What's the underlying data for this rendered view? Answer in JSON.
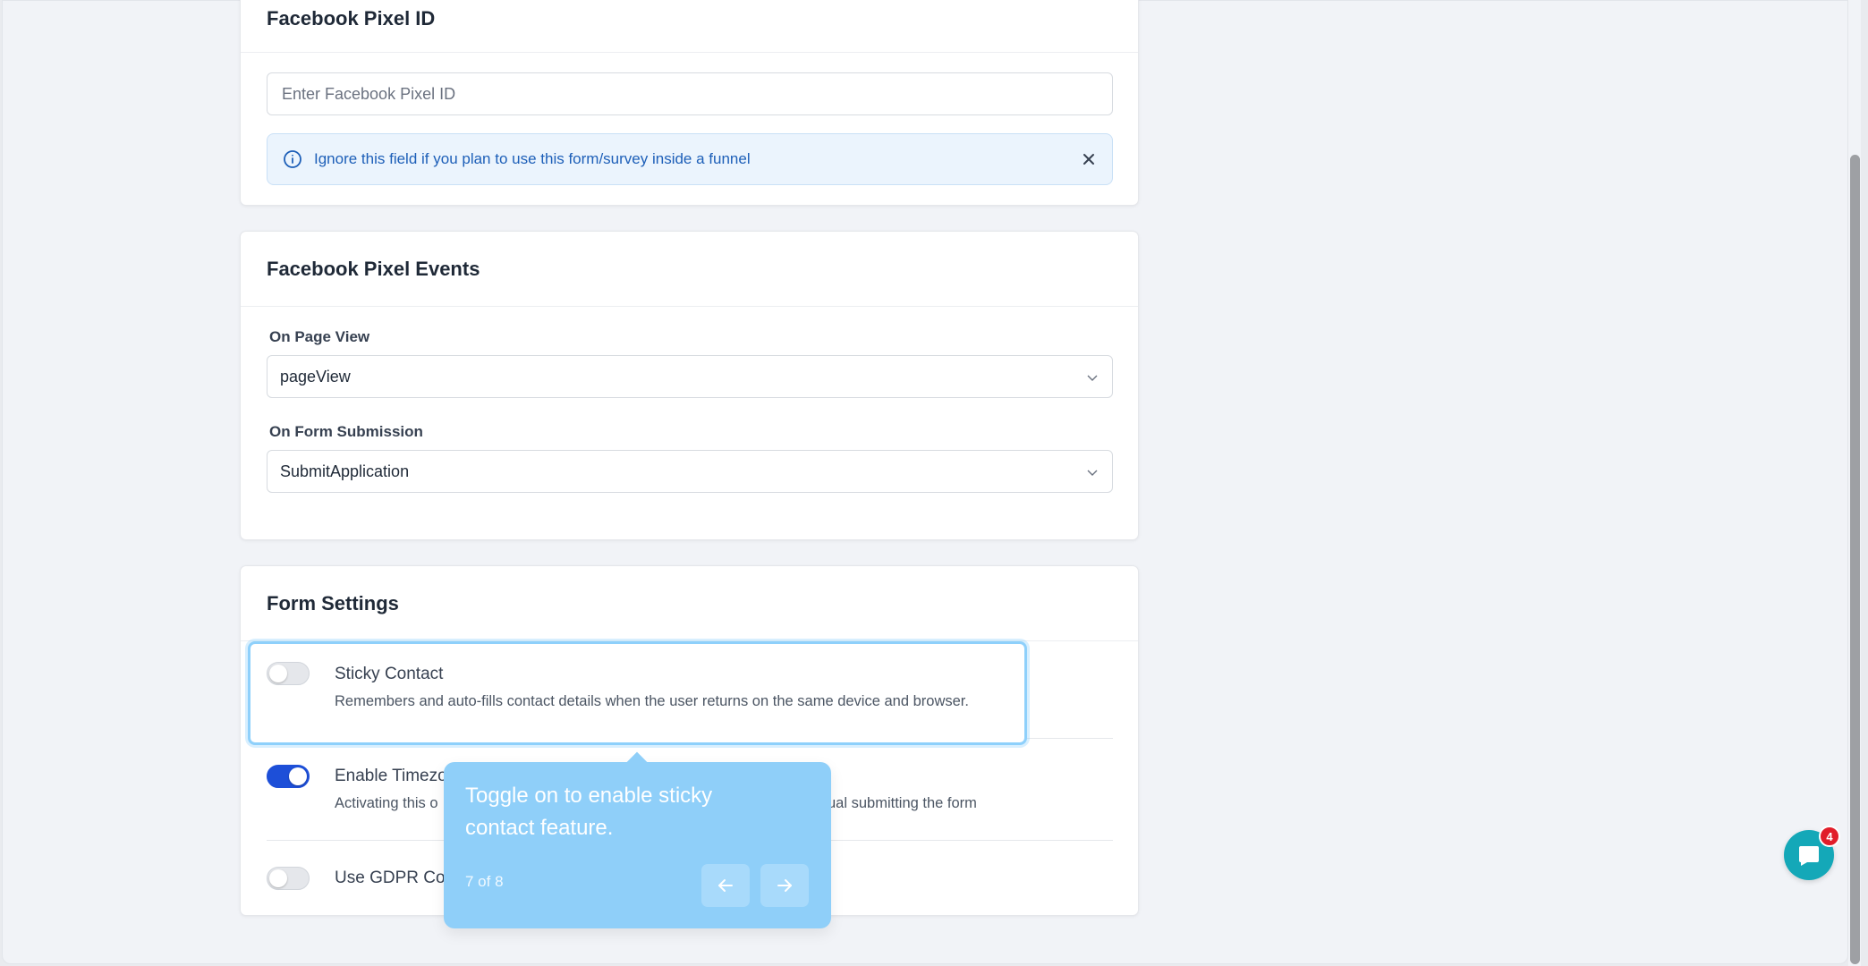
{
  "pixel_id_card": {
    "title": "Facebook Pixel ID",
    "input_placeholder": "Enter Facebook Pixel ID",
    "input_value": "",
    "info_message": "Ignore this field if you plan to use this form/survey inside a funnel",
    "info_icon": "info-circle-icon",
    "close_icon": "close-icon"
  },
  "pixel_events_card": {
    "title": "Facebook Pixel Events",
    "page_view_label": "On Page View",
    "page_view_value": "pageView",
    "form_submission_label": "On Form Submission",
    "form_submission_value": "SubmitApplication"
  },
  "form_settings_card": {
    "title": "Form Settings",
    "settings": [
      {
        "title": "Sticky Contact",
        "description": "Remembers and auto-fills contact details when the user returns on the same device and browser.",
        "enabled": false
      },
      {
        "title": "Enable Timezo",
        "description_left": "Activating this o",
        "description_right": "ual submitting the form",
        "enabled": true
      },
      {
        "title": "Use GDPR Co",
        "enabled": false
      }
    ]
  },
  "tour_tooltip": {
    "message": "Toggle on to enable sticky contact feature.",
    "step": "7 of 8",
    "prev_icon": "arrow-left-icon",
    "next_icon": "arrow-right-icon"
  },
  "chat_widget": {
    "icon": "chat-bubble-icon",
    "badge_count": "4"
  },
  "colors": {
    "accent_blue": "#1d4fd8",
    "tooltip_bg": "#8fcff9",
    "info_bg": "#ebf4fd",
    "info_text": "#1d5fb8",
    "chat_bg": "#14a8b8",
    "badge_red": "#e11d2a"
  }
}
